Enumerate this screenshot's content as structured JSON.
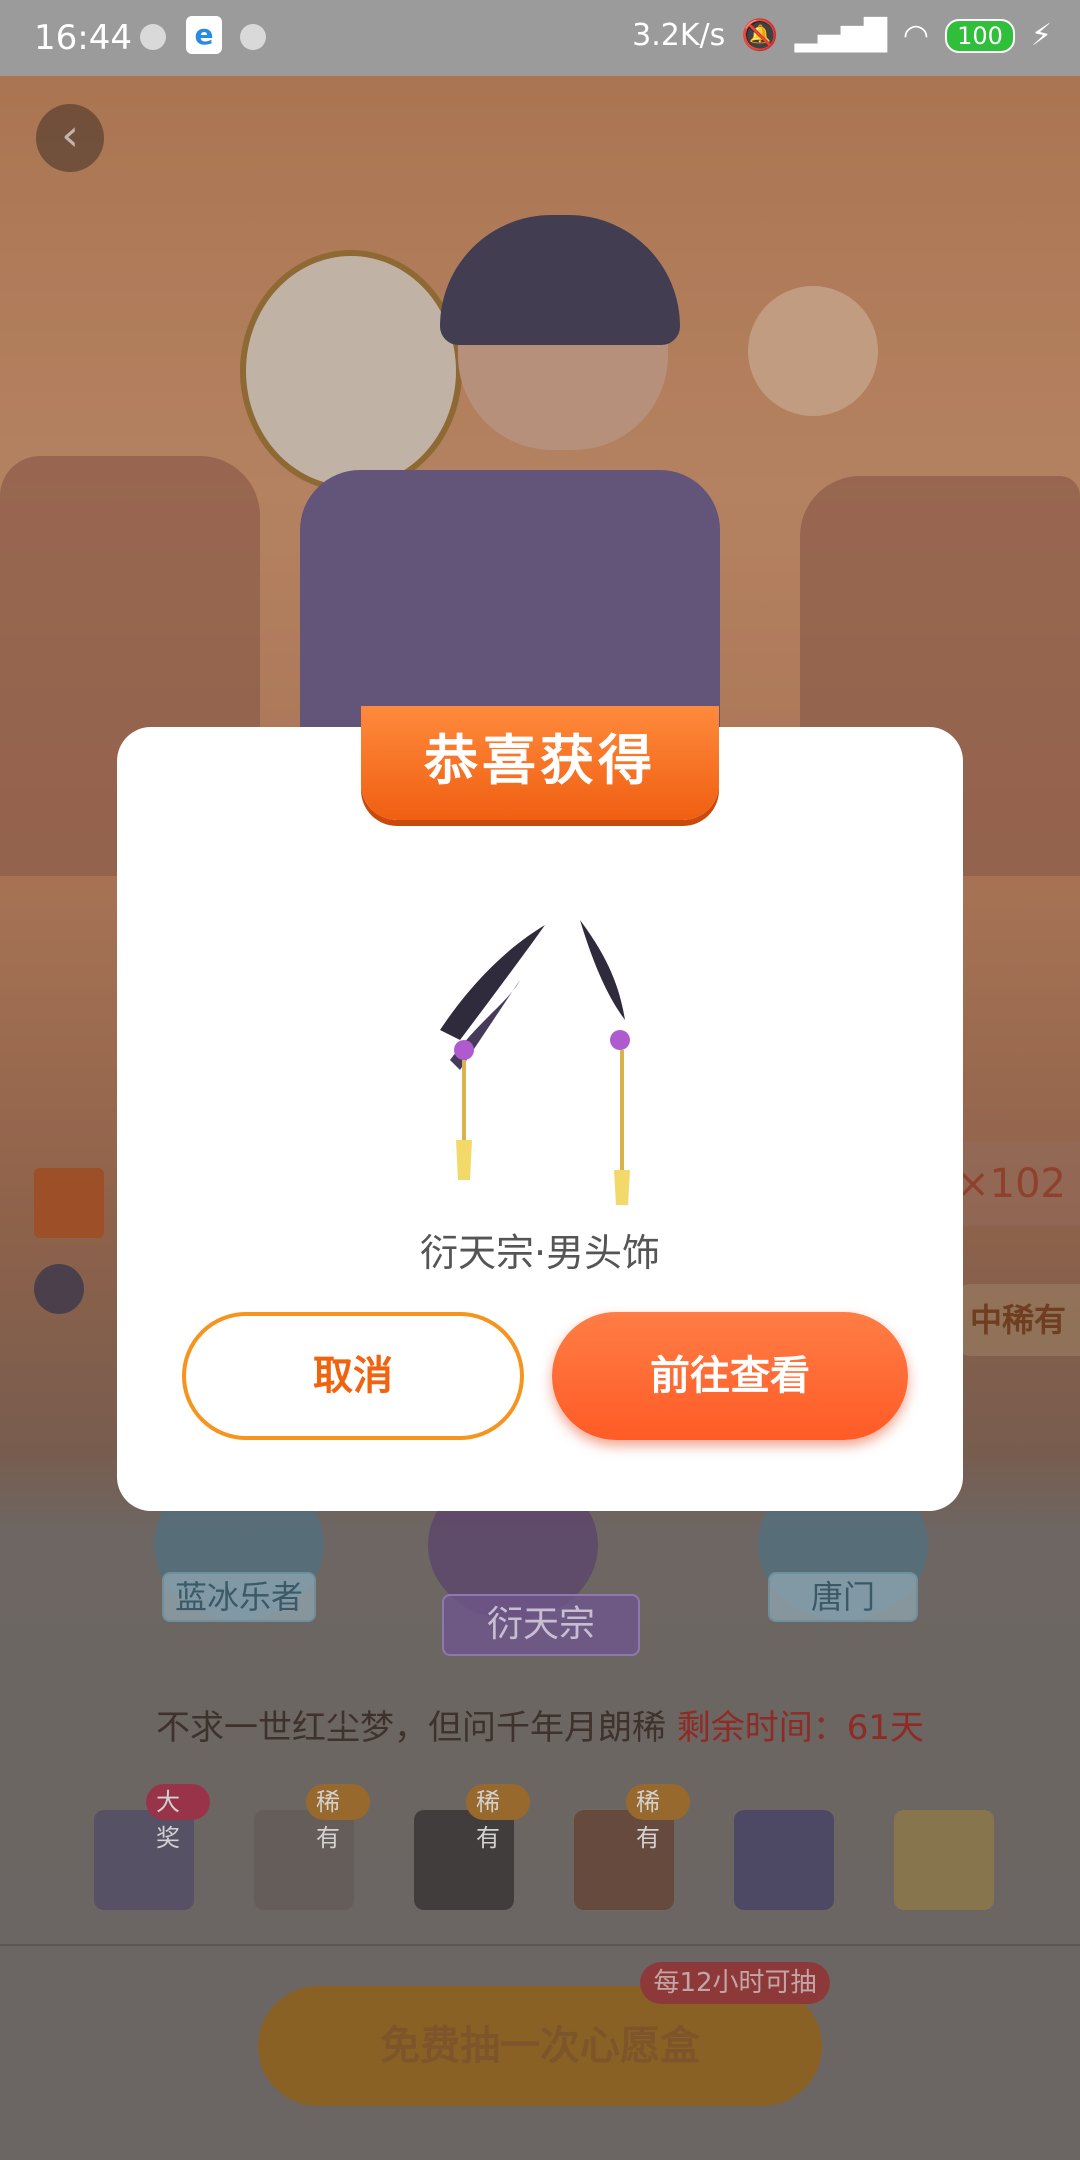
{
  "status_bar": {
    "time": "16:44",
    "network_speed": "3.2K/s",
    "battery": "100",
    "app_icon": "e"
  },
  "page": {
    "back_icon": "‹",
    "side_count": "×102",
    "side_rare": "中稀有",
    "sect_tabs": [
      "蓝冰乐者",
      "衍天宗",
      "唐门"
    ],
    "active_tab": "衍天宗",
    "slogan": "不求一世红尘梦，但问千年月朗稀",
    "remaining_time": "剩余时间：61天",
    "rewards": [
      {
        "badge": "大奖",
        "kind": "big"
      },
      {
        "badge": "稀有",
        "kind": "rare"
      },
      {
        "badge": "稀有",
        "kind": "rare"
      },
      {
        "badge": "稀有",
        "kind": "rare"
      },
      {
        "badge": "",
        "kind": "none"
      },
      {
        "badge": "",
        "kind": "none"
      }
    ],
    "free_button": "免费抽一次心愿盒",
    "free_tag": "每12小时可抽"
  },
  "dialog": {
    "title": "恭喜获得",
    "item_name": "衍天宗·男头饰",
    "cancel": "取消",
    "confirm": "前往查看"
  }
}
